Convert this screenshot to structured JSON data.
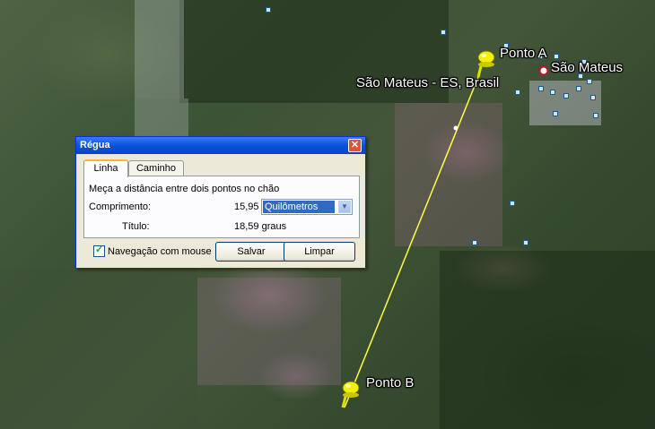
{
  "map": {
    "place_label_1": "São Mateus",
    "place_label_2": "São Mateus - ES, Brasil",
    "pin_a_label": "Ponto A",
    "pin_b_label": "Ponto B",
    "pin_color": "#f2f200",
    "line_color": "#ffff44"
  },
  "dialog": {
    "title": "Régua",
    "close": "✕",
    "tabs": [
      {
        "label": "Linha",
        "active": true
      },
      {
        "label": "Caminho",
        "active": false
      }
    ],
    "description": "Meça a distância entre dois pontos no chão",
    "length_label": "Comprimento:",
    "length_value": "15,95",
    "unit_selected": "Quilômetros",
    "heading_label": "Título:",
    "heading_value": "18,59 graus",
    "mouse_nav_label": "Navegação com mouse",
    "mouse_nav_checked": true,
    "save_label": "Salvar",
    "clear_label": "Limpar"
  }
}
